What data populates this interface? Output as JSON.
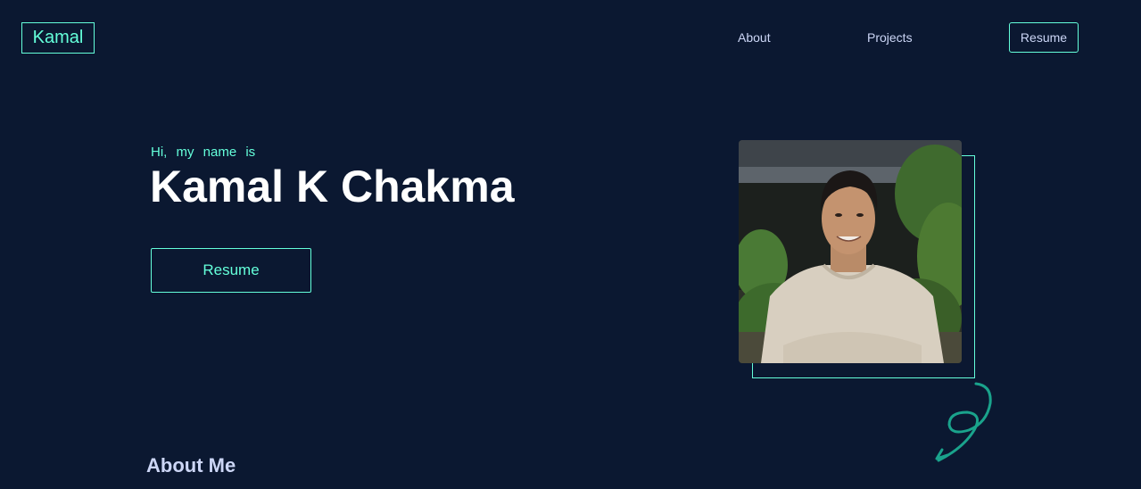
{
  "header": {
    "logo": "Kamal",
    "nav": {
      "about": "About",
      "projects": "Projects",
      "resume": "Resume"
    }
  },
  "hero": {
    "greeting": "Hi, my name is",
    "name": "Kamal K Chakma",
    "resume_button": "Resume"
  },
  "about": {
    "heading": "About Me"
  },
  "colors": {
    "background": "#0b1831",
    "accent": "#64ffda",
    "text_light": "#ccd6f6",
    "heading": "#ffffff"
  }
}
